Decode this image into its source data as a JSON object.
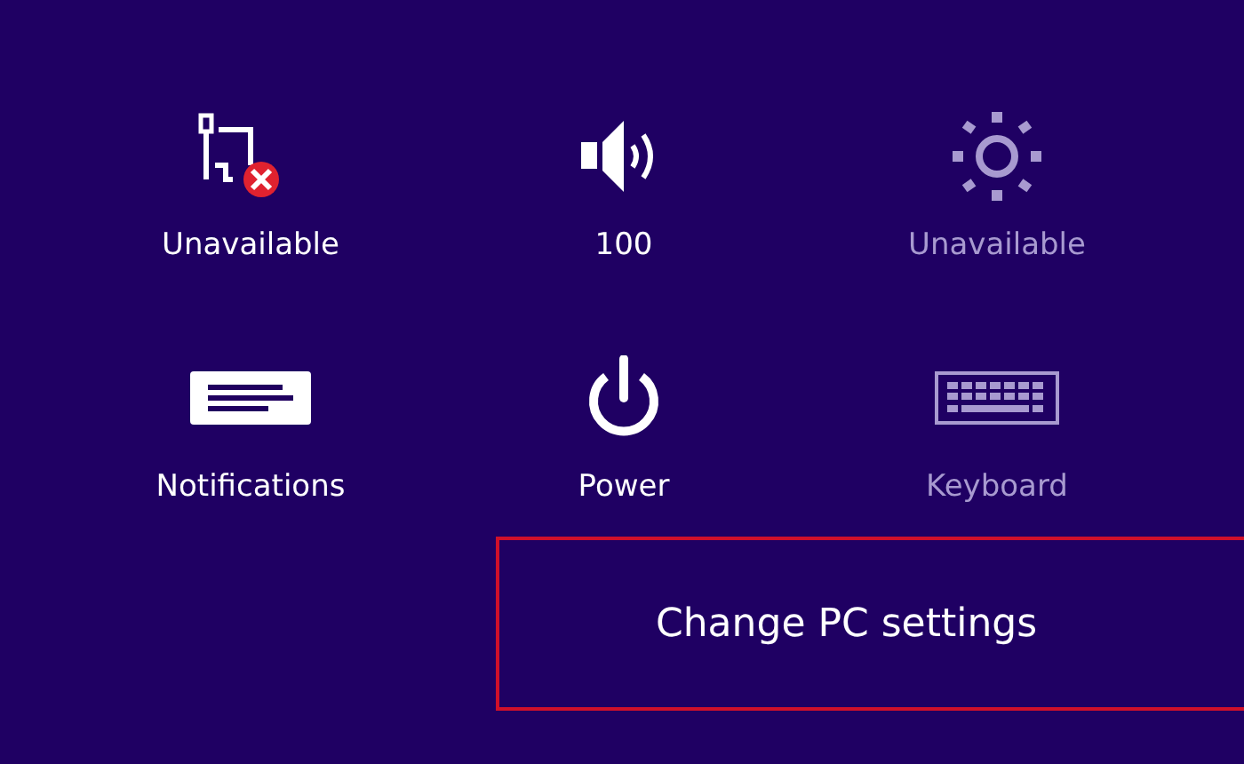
{
  "quick_settings": [
    {
      "kind": "network",
      "label": "Unavailable",
      "disabled": false
    },
    {
      "kind": "volume",
      "label": "100",
      "disabled": false
    },
    {
      "kind": "brightness",
      "label": "Unavailable",
      "disabled": true
    },
    {
      "kind": "notifications",
      "label": "Notifications",
      "disabled": false
    },
    {
      "kind": "power",
      "label": "Power",
      "disabled": false
    },
    {
      "kind": "keyboard",
      "label": "Keyboard",
      "disabled": true
    }
  ],
  "change_settings": {
    "label": "Change PC settings",
    "highlighted": true
  }
}
